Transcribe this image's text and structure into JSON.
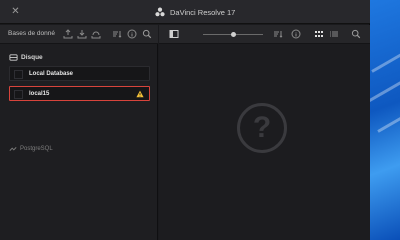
{
  "window": {
    "title": "DaVinci Resolve 17",
    "close_icon": "close-icon",
    "logo_icon": "resolve-logo-icon"
  },
  "left_panel": {
    "header_label": "Bases de donné",
    "toolbar_icons": [
      "upload-icon",
      "download-icon",
      "backup-icon",
      "sort-icon",
      "info-icon",
      "search-icon"
    ],
    "section_label": "Disque",
    "section_icon": "disk-icon",
    "databases": [
      {
        "name": "Local Database",
        "selected": false,
        "warning": false
      },
      {
        "name": "local15",
        "selected": true,
        "warning": true
      }
    ],
    "postgres_label": "PostgreSQL",
    "postgres_icon": "network-icon"
  },
  "right_panel": {
    "toolbar_icons": [
      "panel-toggle-icon",
      "sort-icon",
      "info-icon",
      "grid-view-icon",
      "list-view-icon",
      "search-icon"
    ],
    "zoom_level": 0.5,
    "placeholder_icon": "question-icon"
  },
  "colors": {
    "warning_border": "#d8443c",
    "warning_icon": "#f2c037",
    "panel_bg": "#1e1e21"
  }
}
